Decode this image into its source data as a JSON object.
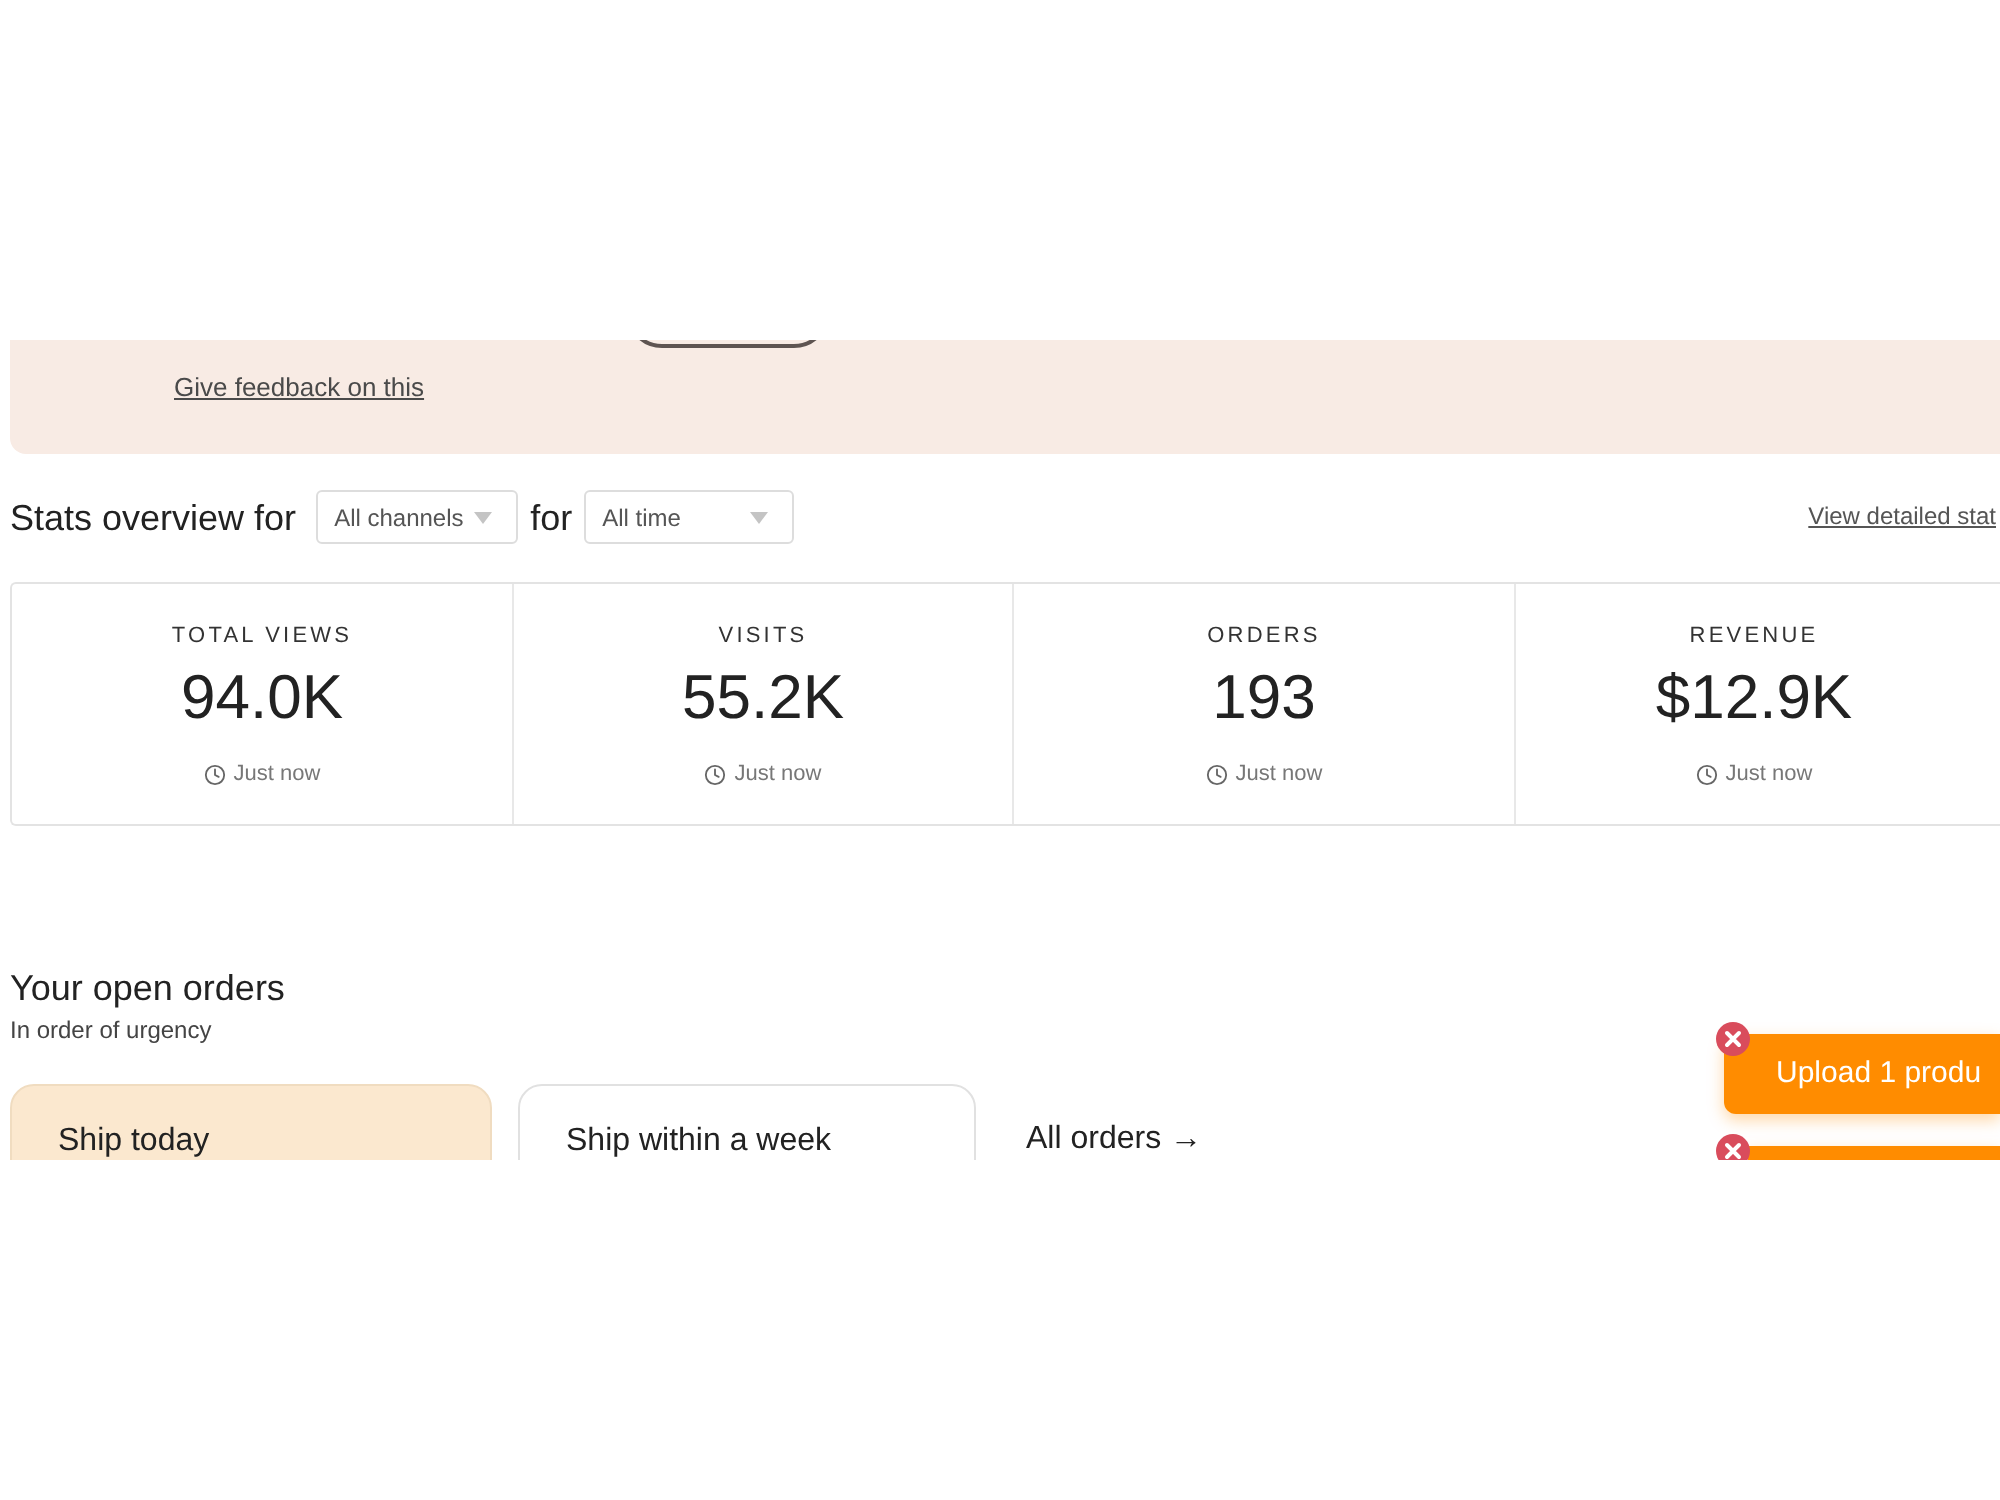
{
  "banner": {
    "feedback_link": "Give feedback on this"
  },
  "stats": {
    "title": "Stats overview for",
    "channel_filter": "All channels",
    "connector": "for",
    "period_filter": "All time",
    "detail_link": "View detailed stat",
    "metrics": [
      {
        "label": "TOTAL VIEWS",
        "value": "94.0K",
        "updated": "Just now"
      },
      {
        "label": "VISITS",
        "value": "55.2K",
        "updated": "Just now"
      },
      {
        "label": "ORDERS",
        "value": "193",
        "updated": "Just now"
      },
      {
        "label": "REVENUE",
        "value": "$12.9K",
        "updated": "Just now"
      }
    ]
  },
  "orders": {
    "title": "Your open orders",
    "subtitle": "In order of urgency",
    "tabs": [
      {
        "label": "Ship today",
        "selected": true
      },
      {
        "label": "Ship within a week",
        "selected": false
      }
    ],
    "all_link": "All orders →"
  },
  "toasts": [
    {
      "message": "Upload 1 produ",
      "dismissible": true
    },
    {
      "dismissible": true
    }
  ]
}
